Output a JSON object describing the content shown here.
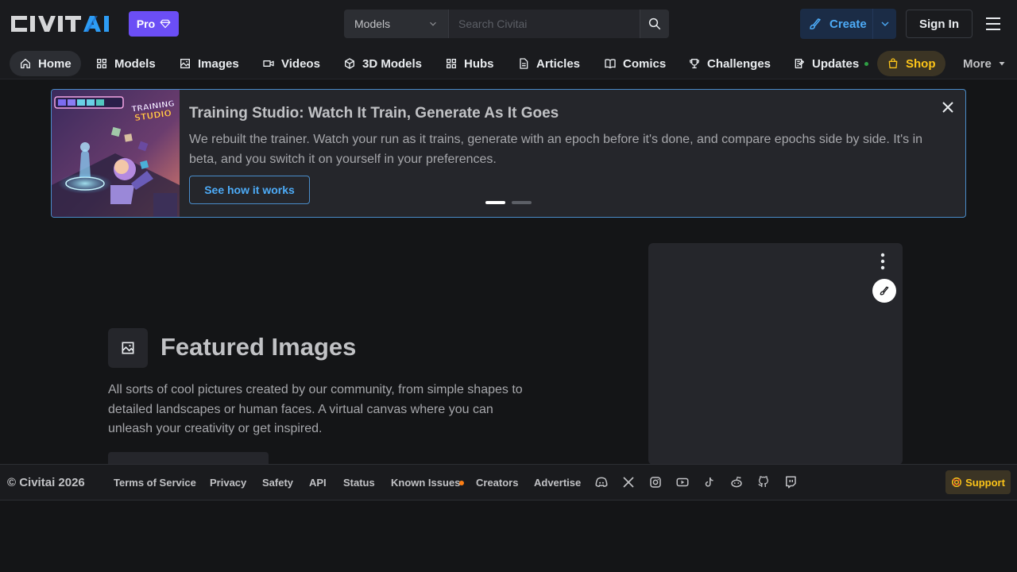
{
  "header": {
    "logo_text": "CIVITAI",
    "pro_label": "Pro",
    "search_scope": "Models",
    "search_placeholder": "Search Civitai",
    "search_shortcut": "/",
    "create_label": "Create",
    "signin_label": "Sign In"
  },
  "nav": {
    "items": [
      {
        "label": "Home",
        "icon": "home-icon"
      },
      {
        "label": "Models",
        "icon": "grid-icon"
      },
      {
        "label": "Images",
        "icon": "photo-icon"
      },
      {
        "label": "Videos",
        "icon": "video-icon"
      },
      {
        "label": "3D Models",
        "icon": "cube-icon"
      },
      {
        "label": "Hubs",
        "icon": "grid-icon"
      },
      {
        "label": "Articles",
        "icon": "file-icon"
      },
      {
        "label": "Comics",
        "icon": "book-icon"
      },
      {
        "label": "Challenges",
        "icon": "trophy-icon"
      },
      {
        "label": "Updates",
        "icon": "notes-icon"
      },
      {
        "label": "Shop",
        "icon": "bag-icon"
      }
    ],
    "more_label": "More"
  },
  "banner": {
    "image_text": "TRAINING STUDIO",
    "title": "Training Studio: Watch It Train, Generate As It Goes",
    "description": "We rebuilt the trainer. Watch your run as it trains, generate with an epoch before it's done, and compare epochs side by side. It's in beta, and you switch it on yourself in your preferences.",
    "button_label": "See how it works",
    "slides_total": 2,
    "slide_active": 1
  },
  "featured": {
    "title": "Featured Images",
    "description": "All sorts of cool pictures created by our community, from simple shapes to detailed landscapes or human faces. A virtual canvas where you can unleash your creativity or get inspired."
  },
  "footer": {
    "copyright": "© Civitai 2026",
    "links": [
      "Terms of Service",
      "Privacy",
      "Safety",
      "API",
      "Status",
      "Known Issues",
      "Creators",
      "Advertise"
    ],
    "socials": [
      "discord-icon",
      "x-icon",
      "instagram-icon",
      "youtube-icon",
      "tiktok-icon",
      "reddit-icon",
      "github-icon",
      "twitch-icon"
    ],
    "support_label": "Support"
  },
  "colors": {
    "background": "#141517",
    "surface": "#1a1b1e",
    "card": "#25262b",
    "accent_blue": "#4dabf7",
    "pro_purple": "#6b4ef5",
    "shop_yellow": "#fcc419"
  }
}
